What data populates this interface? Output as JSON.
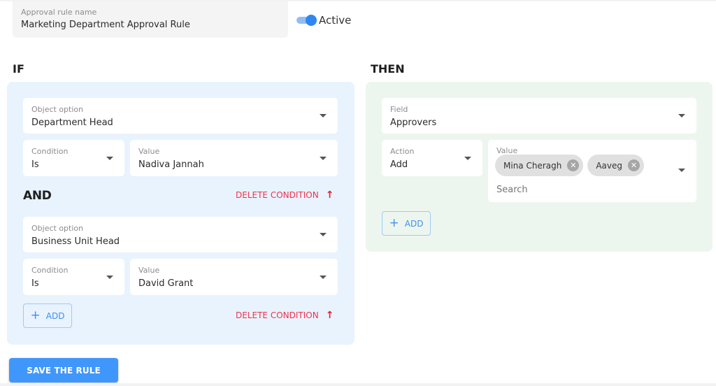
{
  "rule_name": {
    "label": "Approval rule name",
    "value": "Marketing Department Approval Rule"
  },
  "status_toggle": {
    "label": "Active",
    "on": true,
    "accent": "#2f86f0"
  },
  "if_section": {
    "title": "IF",
    "conditions": [
      {
        "object_option": {
          "label": "Object option",
          "value": "Department Head"
        },
        "condition": {
          "label": "Condition",
          "value": "Is"
        },
        "value": {
          "label": "Value",
          "value": "Nadiva Jannah"
        }
      },
      {
        "object_option": {
          "label": "Object option",
          "value": "Business Unit Head"
        },
        "condition": {
          "label": "Condition",
          "value": "Is"
        },
        "value": {
          "label": "Value",
          "value": "David Grant"
        }
      }
    ],
    "joiner": "AND",
    "delete_label": "DELETE CONDITION",
    "add_label": "ADD"
  },
  "then_section": {
    "title": "THEN",
    "field": {
      "label": "Field",
      "value": "Approvers"
    },
    "action": {
      "label": "Action",
      "value": "Add"
    },
    "value": {
      "label": "Value",
      "chips": [
        "Mina Cheragh",
        "Aaveg"
      ],
      "search_placeholder": "Search"
    },
    "add_label": "ADD"
  },
  "save_button": {
    "label": "SAVE THE RULE"
  },
  "colors": {
    "if_panel": "#e8f3fe",
    "then_panel": "#edf6ee",
    "primary": "#4097fb",
    "danger": "#f0324c"
  }
}
